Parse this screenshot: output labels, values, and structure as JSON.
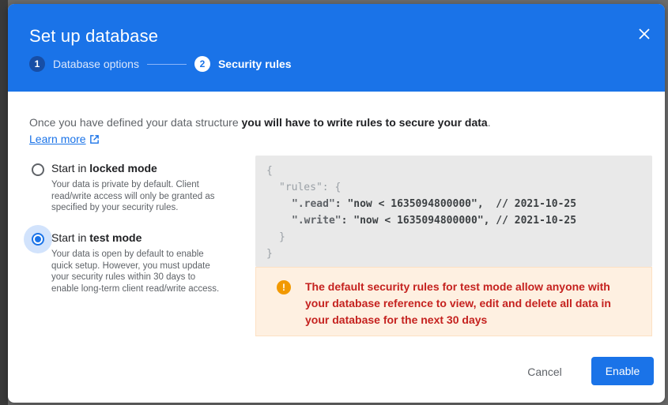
{
  "dialog": {
    "title": "Set up database",
    "close_icon": "close-icon"
  },
  "stepper": {
    "steps": [
      {
        "number": "1",
        "label": "Database options",
        "state": "completed"
      },
      {
        "number": "2",
        "label": "Security rules",
        "state": "active"
      }
    ]
  },
  "intro": {
    "text_prefix": "Once you have defined your data structure ",
    "text_bold": "you will have to write rules to secure your data",
    "text_suffix": ".",
    "learn_more": "Learn more",
    "learn_more_icon": "open-in-new-icon"
  },
  "options": [
    {
      "title_prefix": "Start in ",
      "title_bold": "locked mode",
      "description": "Your data is private by default. Client read/write access will only be granted as specified by your security rules.",
      "selected": false
    },
    {
      "title_prefix": "Start in ",
      "title_bold": "test mode",
      "description": "Your data is open by default to enable quick setup. However, you must update your security rules within 30 days to enable long-term client read/write access.",
      "selected": true
    }
  ],
  "code": {
    "open_brace": "{",
    "rules_key": "\"rules\": {",
    "read_key": "\".read\"",
    "read_value": "\"now < 1635094800000\",",
    "read_comment": "// 2021-10-25",
    "write_key": "\".write\"",
    "write_value": "\"now < 1635094800000\",",
    "write_comment": "// 2021-10-25",
    "inner_close": "}",
    "outer_close": "}"
  },
  "warning": {
    "icon": "!",
    "text": "The default security rules for test mode allow anyone with your database reference to view, edit and delete all data in your database for the next 30 days"
  },
  "actions": {
    "cancel": "Cancel",
    "enable": "Enable"
  },
  "colors": {
    "primary": "#1a73e8",
    "warning_bg": "#fef0e1",
    "warning_text": "#c5221f",
    "warning_icon": "#f29900"
  }
}
